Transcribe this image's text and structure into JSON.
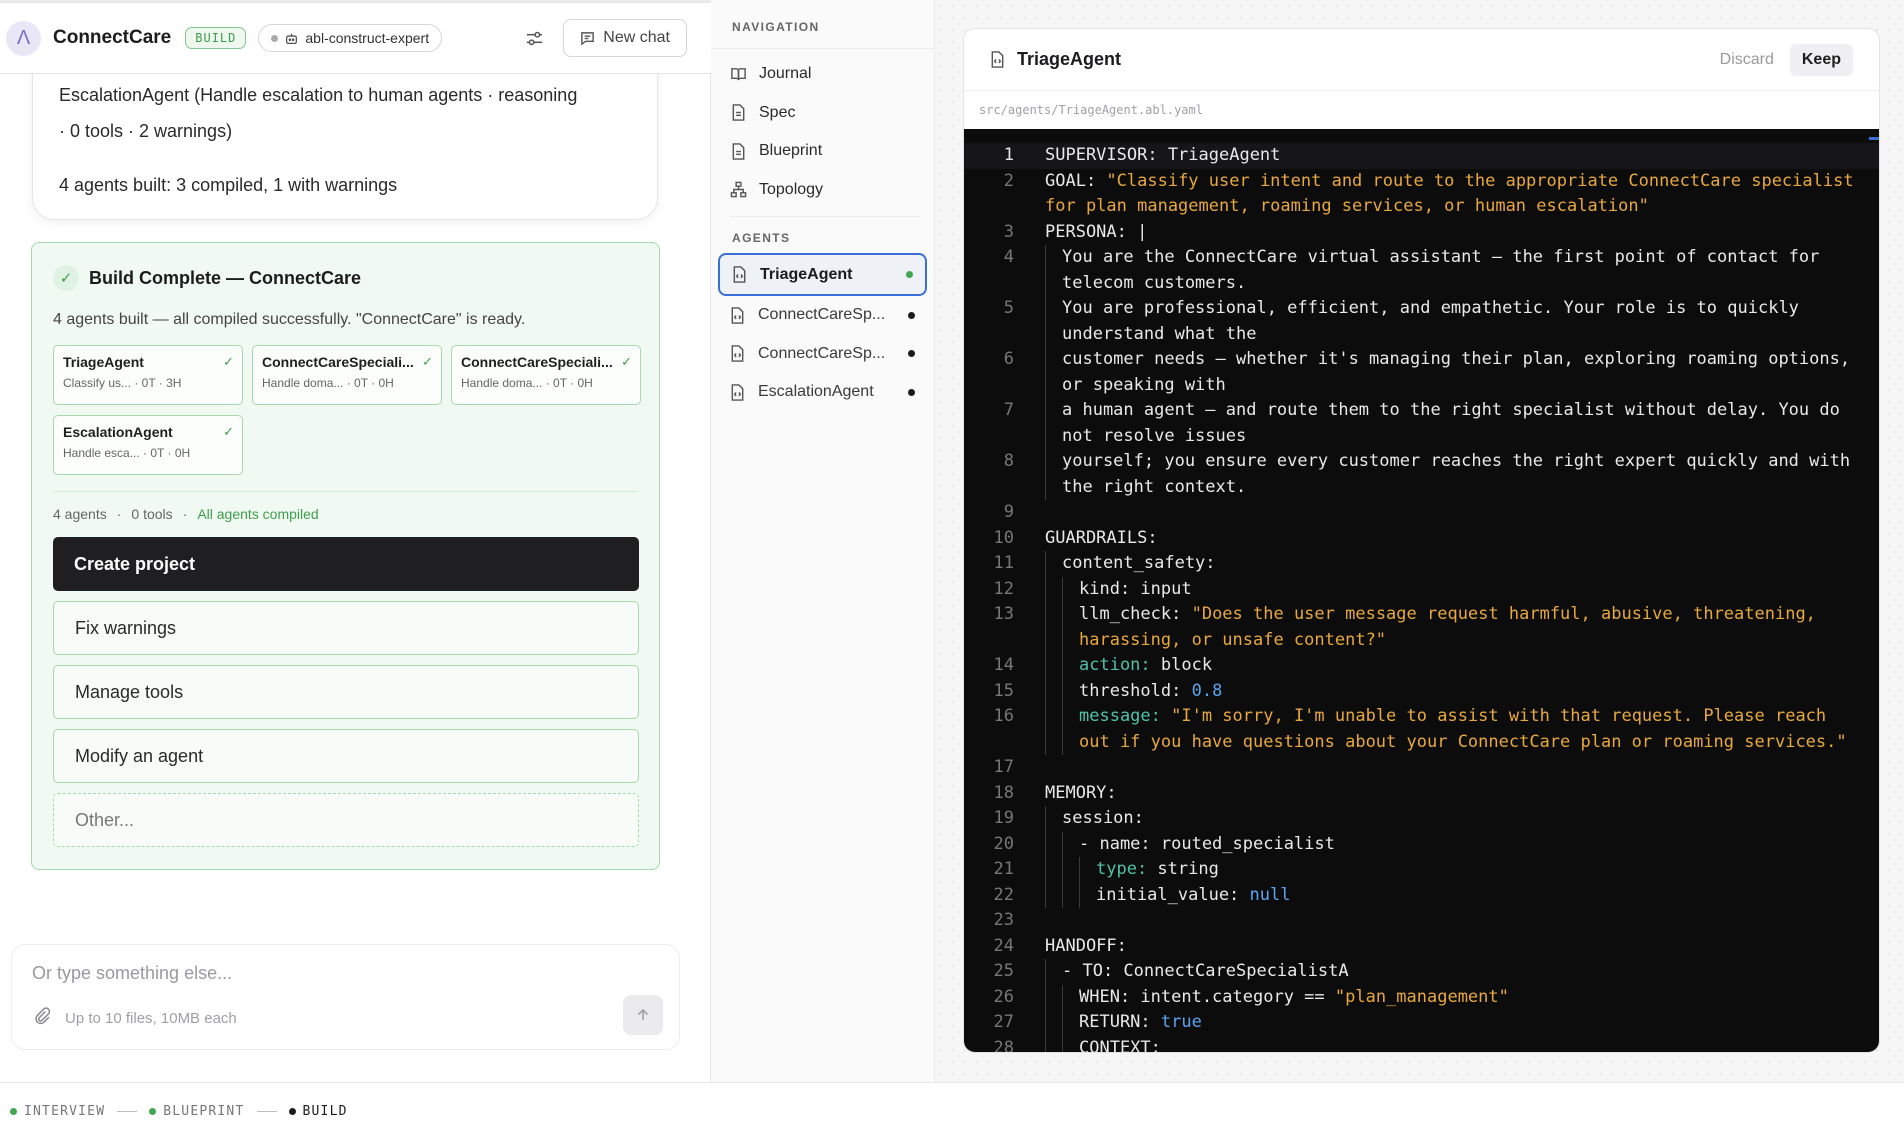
{
  "header": {
    "app_title": "ConnectCare",
    "mode_badge": "BUILD",
    "model_chip": "abl-construct-expert",
    "new_chat_label": "New chat"
  },
  "chat": {
    "prev_message": "EscalationAgent (Handle escalation to human agents · reasoning · 0 tools · 2 warnings)",
    "prev_summary": "4 agents built: 3 compiled, 1 with warnings",
    "build_card": {
      "title": "Build Complete — ConnectCare",
      "subtitle": "4 agents built — all compiled successfully. \"ConnectCare\" is ready.",
      "agents": [
        {
          "name": "TriageAgent",
          "meta": "Classify us... · 0T · 3H"
        },
        {
          "name": "ConnectCareSpeciali...",
          "meta": "Handle doma... · 0T · 0H"
        },
        {
          "name": "ConnectCareSpeciali...",
          "meta": "Handle doma... · 0T · 0H"
        },
        {
          "name": "EscalationAgent",
          "meta": "Handle esca... · 0T · 0H"
        }
      ],
      "stats": {
        "agents": "4 agents",
        "sep": "·",
        "tools": "0 tools",
        "status": "All agents compiled"
      },
      "primary_action": "Create project",
      "actions": [
        "Fix warnings",
        "Manage tools",
        "Modify an agent"
      ],
      "other_action": "Other..."
    },
    "composer": {
      "placeholder": "Or type something else...",
      "files_hint": "Up to 10 files, 10MB each"
    }
  },
  "nav": {
    "section_navigation": "NAVIGATION",
    "items": [
      "Journal",
      "Spec",
      "Blueprint",
      "Topology"
    ],
    "section_agents": "AGENTS",
    "agents": [
      "TriageAgent",
      "ConnectCareSp...",
      "ConnectCareSp...",
      "EscalationAgent"
    ]
  },
  "editor": {
    "title": "TriageAgent",
    "discard_label": "Discard",
    "keep_label": "Keep",
    "path": "src/agents/TriageAgent.abl.yaml",
    "line_numbers": [
      "1",
      "2",
      "3",
      "4",
      "5",
      "6",
      "7",
      "8",
      "9",
      "10",
      "11",
      "12",
      "13",
      "14",
      "15",
      "16",
      "17",
      "18",
      "19",
      "20",
      "21",
      "22",
      "23",
      "24",
      "25",
      "26",
      "27",
      "28"
    ],
    "lines": {
      "l1": "SUPERVISOR: TriageAgent",
      "l2k": "GOAL: ",
      "l2s": "\"Classify user intent and route to the appropriate ConnectCare specialist for plan management, roaming services, or human escalation\"",
      "l3": "PERSONA: |",
      "l4": "You are the ConnectCare virtual assistant — the first point of contact for telecom customers.",
      "l5": "You are professional, efficient, and empathetic. Your role is to quickly understand what the",
      "l6": "customer needs — whether it's managing their plan, exploring roaming options, or speaking with",
      "l7": "a human agent — and route them to the right specialist without delay. You do not resolve issues",
      "l8": "yourself; you ensure every customer reaches the right expert quickly and with the right context.",
      "l10": "GUARDRAILS:",
      "l11": "content_safety:",
      "l12": "kind: input",
      "l13k": "llm_check: ",
      "l13s": "\"Does the user message request harmful, abusive, threatening, harassing, or unsafe content?\"",
      "l14k": "action:",
      "l14v": " block",
      "l15k": "threshold: ",
      "l15n": "0.8",
      "l16k": "message:",
      "l16s": " \"I'm sorry, I'm unable to assist with that request. Please reach out if you have questions about your ConnectCare plan or roaming services.\"",
      "l18": "MEMORY:",
      "l19": "session:",
      "l20": "- name: routed_specialist",
      "l21k": "type:",
      "l21v": " string",
      "l22k": "initial_value: ",
      "l22n": "null",
      "l24": "HANDOFF:",
      "l25": "- TO: ConnectCareSpecialistA",
      "l26k": "WHEN: intent.category == ",
      "l26s": "\"plan_management\"",
      "l27k": "RETURN: ",
      "l27n": "true",
      "l28": "CONTEXT:"
    }
  },
  "footer": {
    "steps": [
      "INTERVIEW",
      "BLUEPRINT",
      "BUILD"
    ]
  },
  "icons": {
    "logo": "lambda-logo-icon",
    "model": "robot-icon",
    "settings": "sliders-icon",
    "new_chat": "chat-icon",
    "journal": "book-icon",
    "doc": "document-icon",
    "topology": "hierarchy-icon",
    "agent_file": "code-file-icon",
    "attach": "paperclip-icon",
    "send": "arrow-up-icon"
  },
  "colors": {
    "accent_green": "#3fa652",
    "string": "#e8a83d",
    "number": "#5ba3f0",
    "key_teal": "#4dc3a7",
    "selection_blue": "#3a6fd8"
  }
}
